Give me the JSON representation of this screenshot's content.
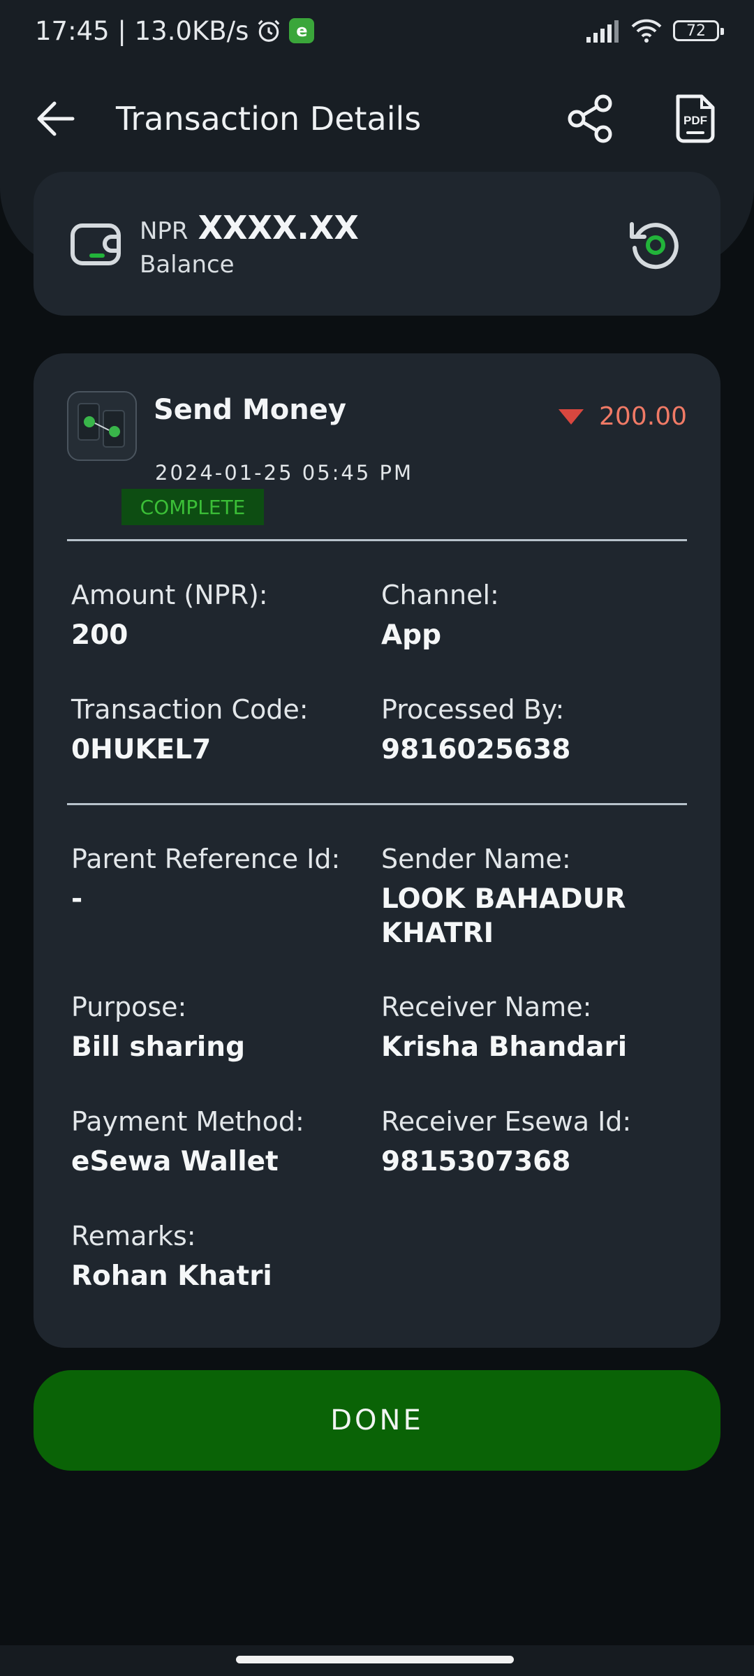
{
  "status_bar": {
    "time_speed": "17:45 | 13.0KB/s",
    "battery": "72",
    "icons": [
      "alarm-icon",
      "esewa-app-icon",
      "signal-icon",
      "wifi-icon",
      "battery-icon"
    ]
  },
  "header": {
    "title": "Transaction Details",
    "actions": [
      "share-icon",
      "pdf-icon"
    ],
    "pdf_text": "PDF"
  },
  "balance": {
    "currency": "NPR",
    "amount": "XXXX.XX",
    "label": "Balance"
  },
  "transaction": {
    "type": "Send Money",
    "amount": "200.00",
    "datetime": "2024-01-25 05:45 PM",
    "status": "COMPLETE",
    "fields": {
      "amount_label": "Amount (NPR):",
      "amount_value": "200",
      "channel_label": "Channel:",
      "channel_value": "App",
      "code_label": "Transaction Code:",
      "code_value": "0HUKEL7",
      "processed_label": "Processed By:",
      "processed_value": "9816025638",
      "parent_ref_label": "Parent Reference Id:",
      "parent_ref_value": "-",
      "sender_label": "Sender Name:",
      "sender_value": "LOOK BAHADUR KHATRI",
      "purpose_label": "Purpose:",
      "purpose_value": "Bill sharing",
      "receiver_label": "Receiver Name:",
      "receiver_value": "Krisha Bhandari",
      "method_label": "Payment Method:",
      "method_value": "eSewa Wallet",
      "receiver_id_label": "Receiver Esewa Id:",
      "receiver_id_value": "9815307368",
      "remarks_label": "Remarks:",
      "remarks_value": "Rohan Khatri"
    }
  },
  "done_label": "DONE",
  "colors": {
    "background": "#0b0f12",
    "card": "#1f262e",
    "accent_green": "#0a6306",
    "debit_red": "#d9473f",
    "status_green": "#3bbf37"
  }
}
